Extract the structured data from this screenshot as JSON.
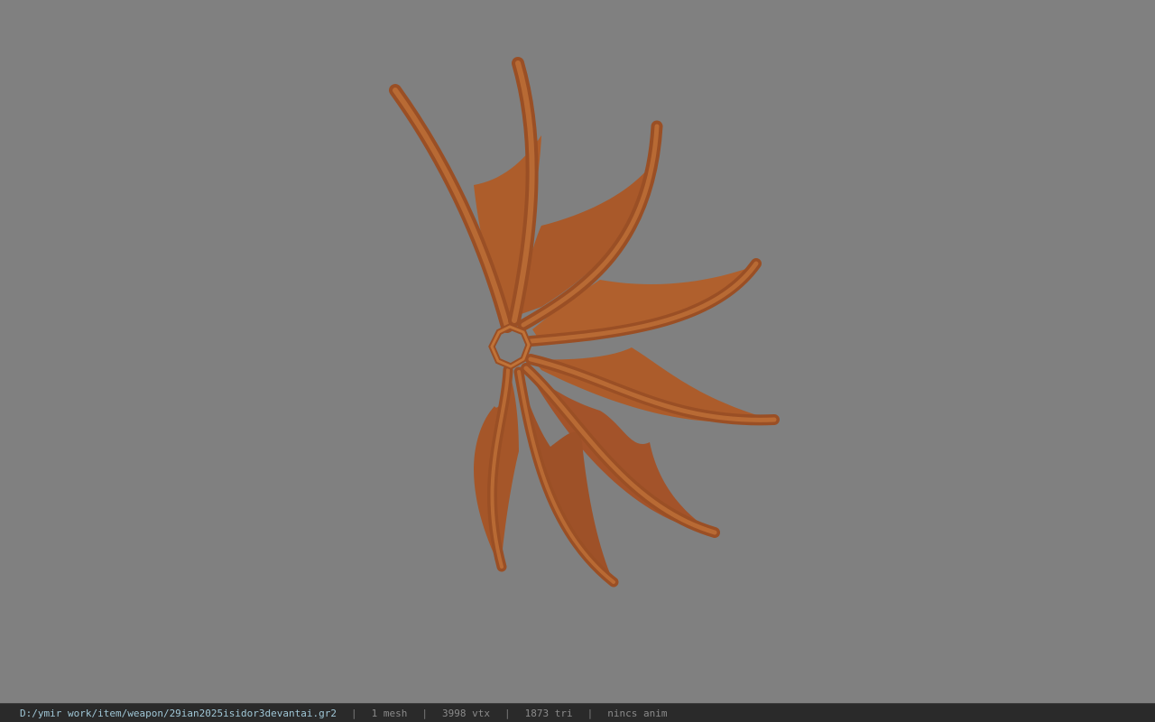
{
  "viewer": {
    "background_color": "#808080",
    "model_color": "#b0602c",
    "model_shadow_color": "#8a4520",
    "model_icon": "bat-wing-model-icon"
  },
  "status_bar": {
    "file_path": "D:/ymir work/item/weapon/29ian2025isidor3devantai.gr2",
    "separator": "|",
    "mesh_count": "1 mesh",
    "vertex_count": "3998 vtx",
    "triangle_count": "1873 tri",
    "animation": "nincs anim"
  }
}
